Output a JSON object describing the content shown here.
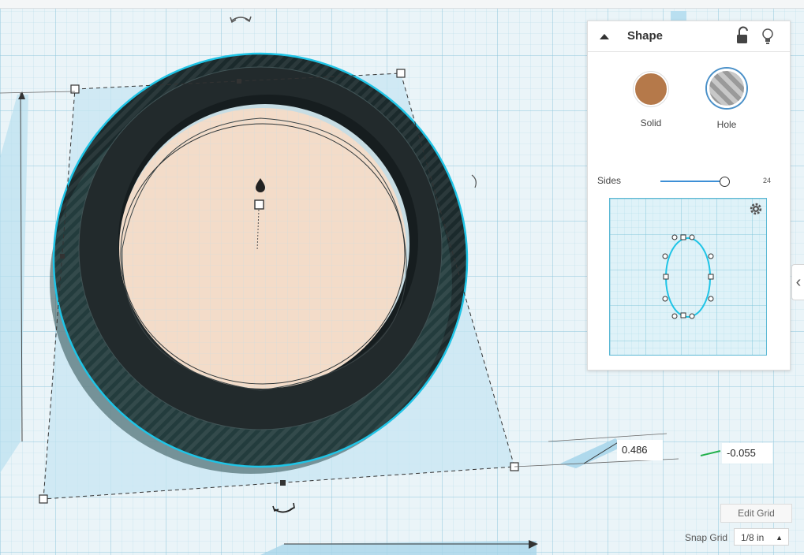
{
  "panel": {
    "title": "Shape",
    "solid_label": "Solid",
    "hole_label": "Hole",
    "sides_label": "Sides",
    "sides_value": "24",
    "sides_level": 0.93
  },
  "dimensions": {
    "a": "0.486",
    "b": "-0.055"
  },
  "grid": {
    "edit_label": "Edit Grid",
    "snap_label": "Snap Grid",
    "snap_value": "1/8 in"
  },
  "icons": {
    "collapse": "caret-up-icon",
    "lock": "unlock-icon",
    "bulb": "lightbulb-icon",
    "settings": "gear-icon",
    "expand": "chevron-left-icon",
    "rotate": "rotate-arrow-icon",
    "drop": "drop-icon"
  },
  "colors": {
    "selection": "#1fc4e6",
    "solid": "#b5794a",
    "ring": "#2b3a3d",
    "inner": "#f3dcc9",
    "workplane": "#eaf4f8",
    "accent": "#3d8fd6"
  }
}
